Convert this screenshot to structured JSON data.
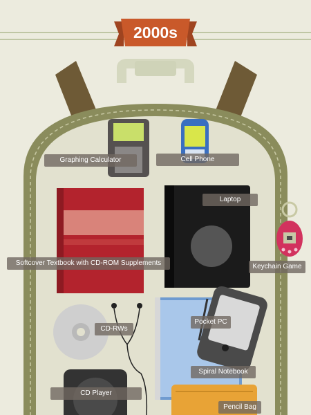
{
  "title": "2000s",
  "colors": {
    "background": "#ecebde",
    "backpack_body": "#e2e1cf",
    "backpack_trim": "#8a8c5c",
    "straps": "#6e5a36",
    "ribbon": "#c9592a",
    "label_bg": "#706860"
  },
  "items": [
    {
      "id": "graphing-calculator",
      "label": "Graphing Calculator",
      "icon": "calculator-icon"
    },
    {
      "id": "cell-phone",
      "label": "Cell Phone",
      "icon": "phone-icon"
    },
    {
      "id": "laptop",
      "label": "Laptop",
      "icon": "laptop-icon"
    },
    {
      "id": "textbook",
      "label": "Softcover Textbook with CD-ROM Supplements",
      "icon": "book-icon"
    },
    {
      "id": "keychain-game",
      "label": "Keychain Game",
      "icon": "keychain-game-icon"
    },
    {
      "id": "cd-rws",
      "label": "CD-RWs",
      "icon": "cd-icon"
    },
    {
      "id": "pocket-pc",
      "label": "Pocket PC",
      "icon": "pocket-pc-icon"
    },
    {
      "id": "spiral-notebook",
      "label": "Spiral Notebook",
      "icon": "notebook-icon"
    },
    {
      "id": "cd-player",
      "label": "CD Player",
      "icon": "cd-player-icon"
    },
    {
      "id": "pencil-bag",
      "label": "Pencil Bag",
      "icon": "pencil-bag-icon"
    }
  ]
}
